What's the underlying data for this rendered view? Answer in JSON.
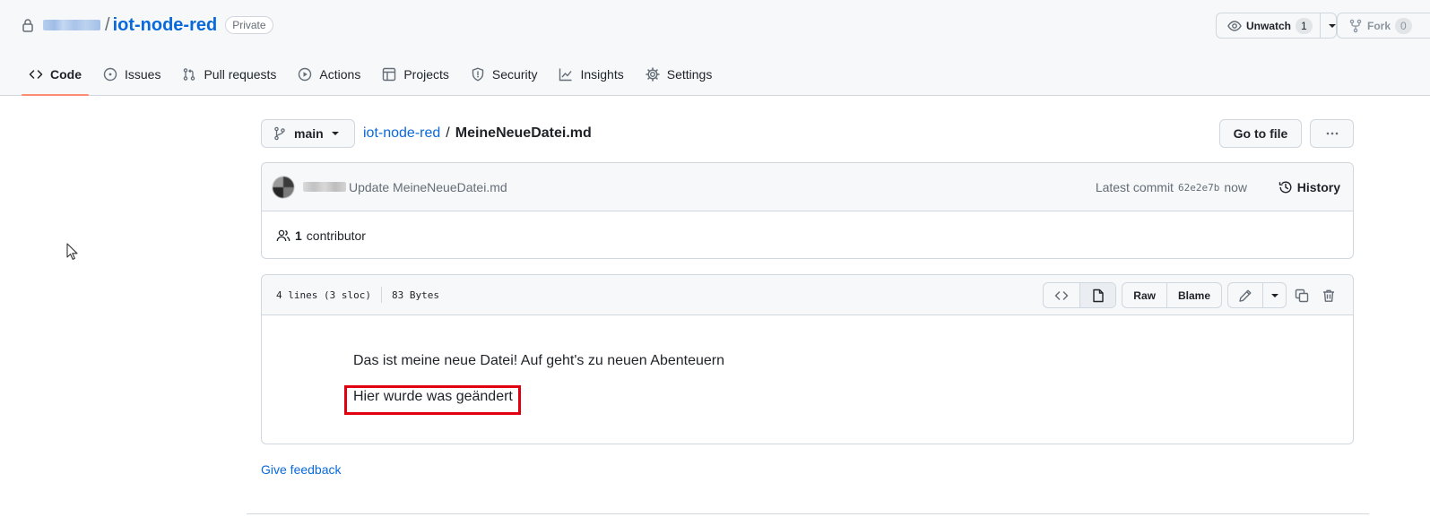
{
  "repo": {
    "name": "iot-node-red",
    "slash": "/",
    "visibility": "Private",
    "unwatch": {
      "label": "Unwatch",
      "count": "1"
    },
    "fork": {
      "label": "Fork",
      "count": "0"
    }
  },
  "tabs": [
    {
      "label": "Code",
      "icon": "code-icon",
      "selected": true
    },
    {
      "label": "Issues",
      "icon": "issue-icon"
    },
    {
      "label": "Pull requests",
      "icon": "pull-request-icon"
    },
    {
      "label": "Actions",
      "icon": "play-icon"
    },
    {
      "label": "Projects",
      "icon": "table-icon"
    },
    {
      "label": "Security",
      "icon": "shield-icon"
    },
    {
      "label": "Insights",
      "icon": "graph-icon"
    },
    {
      "label": "Settings",
      "icon": "gear-icon"
    }
  ],
  "file_nav": {
    "branch": "main",
    "breadcrumb_repo": "iot-node-red",
    "breadcrumb_sep": "/",
    "file_name": "MeineNeueDatei.md",
    "goto_label": "Go to file"
  },
  "commit": {
    "message": "Update MeineNeueDatei.md",
    "latest_label": "Latest commit",
    "sha": "62e2e7b",
    "time": "now",
    "history_label": "History",
    "contributor_count": "1",
    "contributor_label": "contributor"
  },
  "file": {
    "lines_info": "4 lines (3 sloc)",
    "size": "83 Bytes",
    "raw_label": "Raw",
    "blame_label": "Blame",
    "content": [
      "Das ist meine neue Datei! Auf geht's zu neuen Abenteuern",
      "Hier wurde was geändert"
    ]
  },
  "feedback_label": "Give feedback",
  "colors": {
    "link": "#0969da",
    "tab_underline": "#fd8c73",
    "highlight": "#e0000f"
  }
}
